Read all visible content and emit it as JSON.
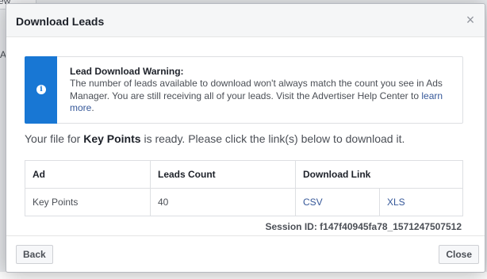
{
  "background": {
    "tab_fragment": "ew",
    "side_fragment": "A"
  },
  "dialog": {
    "title": "Download Leads",
    "close_glyph": "×"
  },
  "warning": {
    "title": "Lead Download Warning:",
    "text": "The number of leads available to download won't always match the count you see in Ads Manager. You are still receiving all of your leads. Visit the Advertiser Help Center to ",
    "link_text": "learn more",
    "text_end": "."
  },
  "ready": {
    "prefix": "Your file for ",
    "name": "Key Points",
    "suffix": " is ready. Please click the link(s) below to download it."
  },
  "table": {
    "headers": [
      "Ad",
      "Leads Count",
      "Download Link"
    ],
    "rows": [
      {
        "ad": "Key Points",
        "leads": "40",
        "csv": "CSV",
        "xls": "XLS"
      }
    ]
  },
  "session": "Session ID: f147f40945fa78_1571247507512",
  "buttons": {
    "back": "Back",
    "close": "Close"
  },
  "colors": {
    "accent": "#1877d4",
    "link": "#365899"
  },
  "icons": {
    "info": "info-icon",
    "close": "close-icon"
  }
}
